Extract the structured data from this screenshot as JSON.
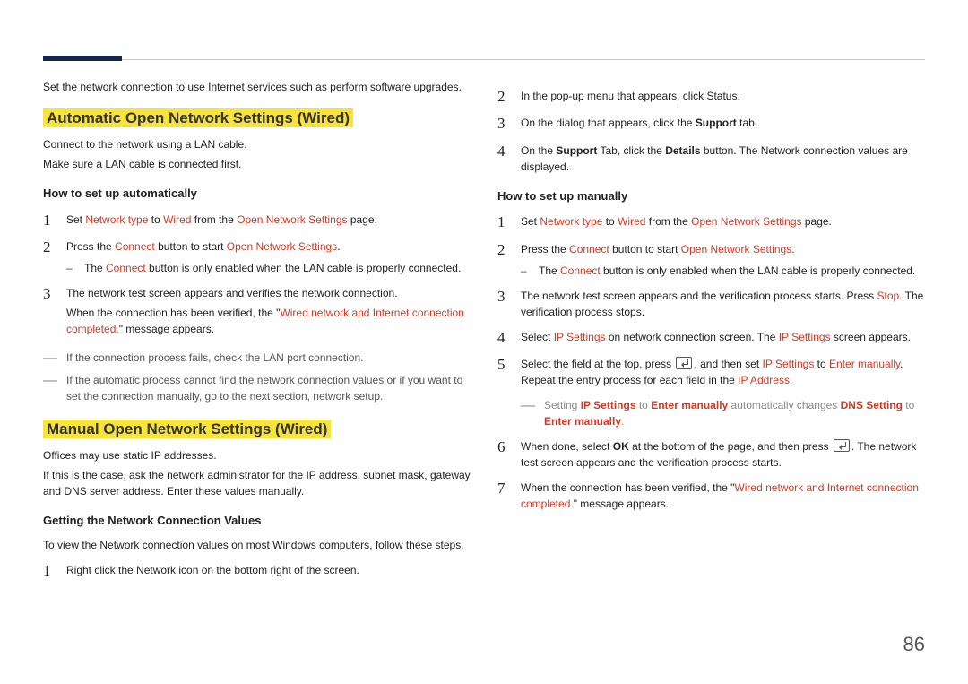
{
  "pageNumber": "86",
  "left": {
    "intro": "Set the network connection to use Internet services such as perform software upgrades.",
    "heading1": "Automatic Open Network Settings (Wired)",
    "h1_sub1": "Connect to the network using a LAN cable.",
    "h1_sub2": "Make sure a LAN cable is connected first.",
    "sub1": "How to set up automatically",
    "step1": {
      "pre": "Set ",
      "a": "Network type",
      "mid": " to ",
      "b": "Wired",
      "post": " from the ",
      "c": "Open Network Settings",
      "end": " page."
    },
    "step2": {
      "pre": "Press the ",
      "a": "Connect",
      "post": " button to start ",
      "b": "Open Network Settings",
      "end": "."
    },
    "step2_note": {
      "pre": "The ",
      "a": "Connect",
      "post": " button is only enabled when the LAN cable is properly connected."
    },
    "step3_a": "The network test screen appears and verifies the network connection.",
    "step3_b": {
      "pre": "When the connection has been verified, the \"",
      "a": "Wired network and Internet connection completed.",
      "post": "\" message appears."
    },
    "note1": "If the connection process fails, check the LAN port connection.",
    "note2": "If the automatic process cannot find the network connection values or if you want to set the connection manually, go to the next section, network setup.",
    "heading2": "Manual Open Network Settings (Wired)",
    "m_p1": "Offices may use static IP addresses.",
    "m_p2": "If this is the case, ask the network administrator for the IP address, subnet mask, gateway and DNS server address. Enter these values manually.",
    "sub2": "Getting the Network Connection Values",
    "g_p1": "To view the Network connection values on most Windows computers, follow these steps.",
    "g_step1": "Right click the Network icon on the bottom right of the screen."
  },
  "right": {
    "g_step2": "In the pop-up menu that appears, click Status.",
    "g_step3": {
      "pre": "On the dialog that appears, click the ",
      "a": "Support",
      "post": " tab."
    },
    "g_step4": {
      "pre": "On the ",
      "a": "Support",
      "mid": " Tab, click the ",
      "b": "Details",
      "post": " button. The Network connection values are displayed."
    },
    "sub1": "How to set up manually",
    "m_step1": {
      "pre": "Set ",
      "a": "Network type",
      "mid": " to ",
      "b": "Wired",
      "post": " from the ",
      "c": "Open Network Settings",
      "end": " page."
    },
    "m_step2": {
      "pre": "Press the ",
      "a": "Connect",
      "post": " button to start ",
      "b": "Open Network Settings",
      "end": "."
    },
    "m_step2_note": {
      "pre": "The ",
      "a": "Connect",
      "post": " button is only enabled when the LAN cable is properly connected."
    },
    "m_step3": {
      "pre": "The network test screen appears and the verification process starts. Press ",
      "a": "Stop",
      "post": ". The verification process stops."
    },
    "m_step4": {
      "pre": "Select ",
      "a": "IP Settings",
      "mid": " on network connection screen. The ",
      "b": "IP Settings",
      "post": " screen appears."
    },
    "m_step5": {
      "pre": "Select the field at the top, press ",
      "mid": ", and then set ",
      "a": "IP Settings",
      "mid2": " to ",
      "b": "Enter manually",
      "post": ". Repeat the entry process for each field in the ",
      "c": "IP Address",
      "end": "."
    },
    "m_step5_note": {
      "pre": "Setting ",
      "a": "IP Settings",
      "mid": " to ",
      "b": "Enter manually",
      "mid2": " automatically changes ",
      "c": "DNS Setting",
      "mid3": " to ",
      "d": "Enter manually",
      "end": "."
    },
    "m_step6": {
      "pre": "When done, select ",
      "a": "OK",
      "mid": " at the bottom of the page, and then press ",
      "post": ". The network test screen appears and the verification process starts."
    },
    "m_step7": {
      "pre": "When the connection has been verified, the \"",
      "a": "Wired network and Internet connection completed.",
      "post": "\" message appears."
    }
  }
}
